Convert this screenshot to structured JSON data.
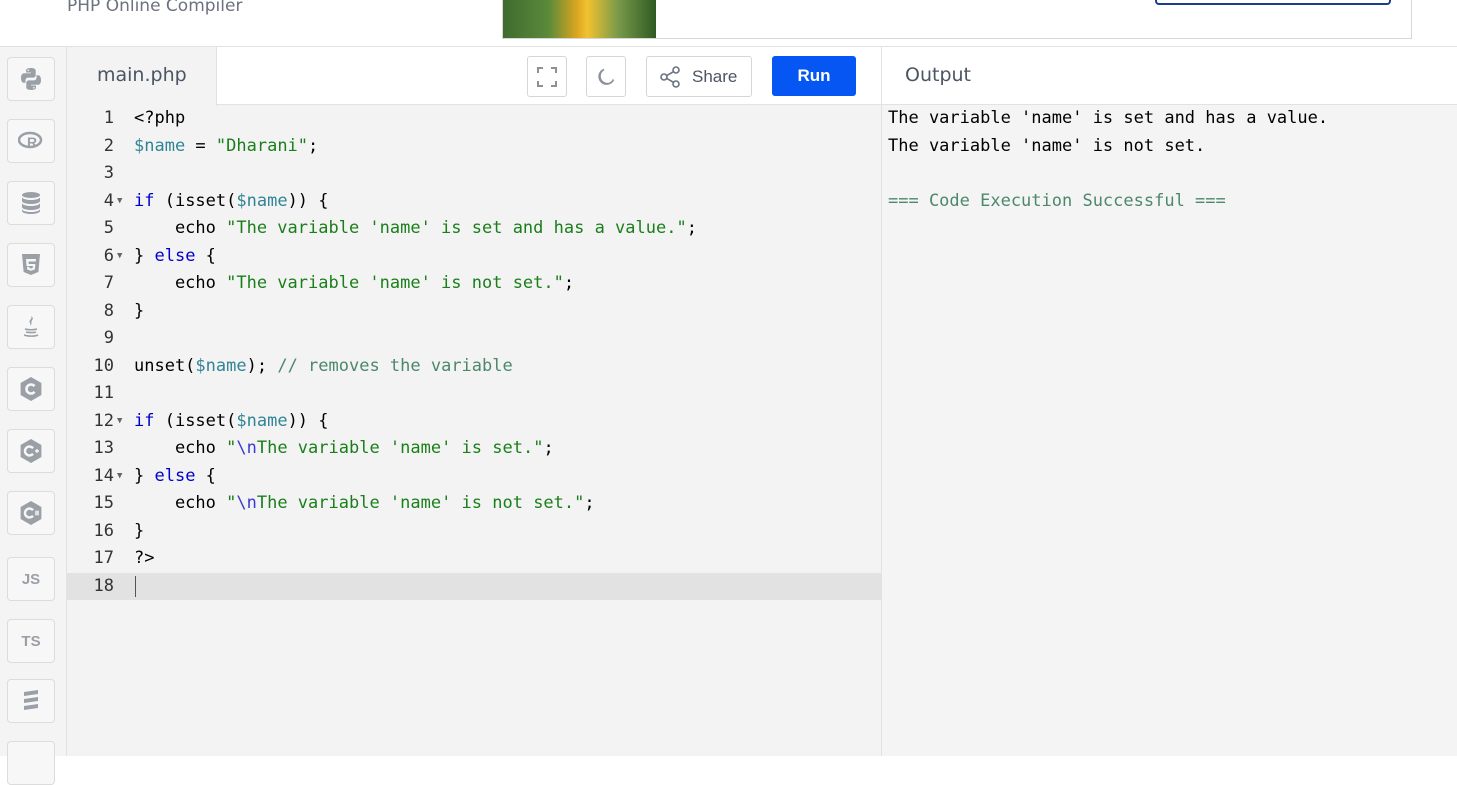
{
  "header": {
    "subtitle": "PHP Online Compiler"
  },
  "sidebar": {
    "items": [
      {
        "name": "python"
      },
      {
        "name": "r"
      },
      {
        "name": "sql"
      },
      {
        "name": "html5"
      },
      {
        "name": "java"
      },
      {
        "name": "c"
      },
      {
        "name": "cpp"
      },
      {
        "name": "csharp"
      },
      {
        "name": "js",
        "label": "JS"
      },
      {
        "name": "ts",
        "label": "TS"
      },
      {
        "name": "go"
      }
    ]
  },
  "editor": {
    "filename": "main.php",
    "share_label": "Share",
    "run_label": "Run",
    "line_numbers": [
      "1",
      "2",
      "3",
      "4",
      "5",
      "6",
      "7",
      "8",
      "9",
      "10",
      "11",
      "12",
      "13",
      "14",
      "15",
      "16",
      "17",
      "18"
    ]
  },
  "output": {
    "title": "Output",
    "lines": [
      "The variable 'name' is set and has a value.",
      "The variable 'name' is not set.",
      "",
      "=== Code Execution Successful ==="
    ]
  }
}
